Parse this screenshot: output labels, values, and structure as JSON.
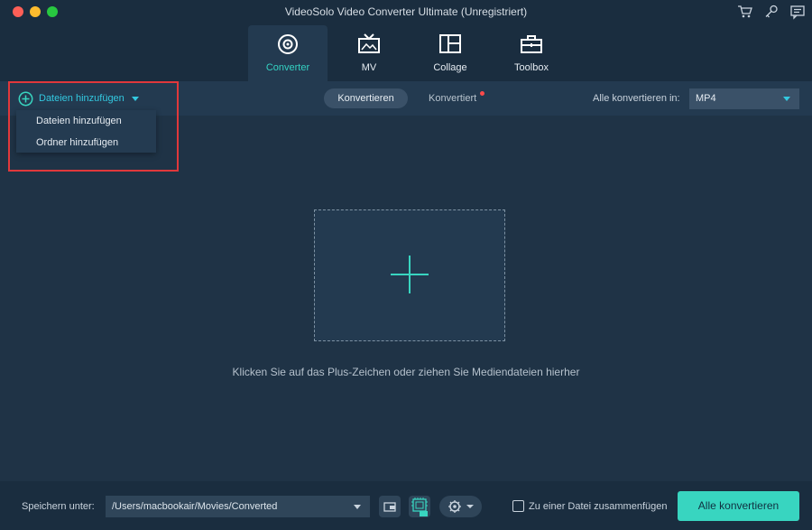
{
  "window": {
    "title": "VideoSolo Video Converter Ultimate (Unregistriert)"
  },
  "title_icons": [
    "cart-icon",
    "key-icon",
    "feedback-icon"
  ],
  "tabs": [
    {
      "label": "Converter",
      "icon": "converter-icon",
      "active": true
    },
    {
      "label": "MV",
      "icon": "tv-icon",
      "active": false
    },
    {
      "label": "Collage",
      "icon": "collage-icon",
      "active": false
    },
    {
      "label": "Toolbox",
      "icon": "toolbox-icon",
      "active": false
    }
  ],
  "toolbar": {
    "add_files_label": "Dateien hinzufügen",
    "segment_convert": "Konvertieren",
    "segment_converted": "Konvertiert",
    "convert_all_to_label": "Alle konvertieren in:",
    "format_value": "MP4"
  },
  "dropdown": {
    "items": [
      "Dateien hinzufügen",
      "Ordner hinzufügen"
    ]
  },
  "main": {
    "drop_hint": "Klicken Sie auf das Plus-Zeichen oder ziehen Sie Mediendateien hierher"
  },
  "bottom": {
    "save_label": "Speichern unter:",
    "save_path": "/Users/macbookair/Movies/Converted",
    "merge_label": "Zu einer Datei zusammenfügen",
    "merge_checked": false,
    "convert_all_button": "Alle konvertieren"
  },
  "colors": {
    "accent": "#38d5c0",
    "background": "#1f3346",
    "highlight_border": "#e0383b"
  }
}
